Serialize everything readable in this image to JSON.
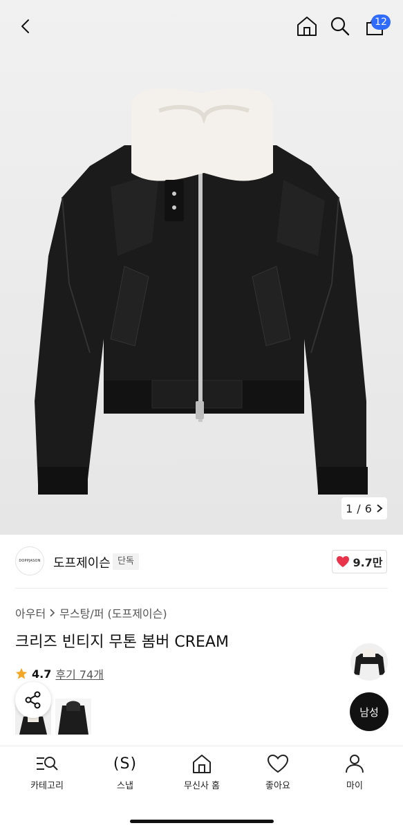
{
  "header": {
    "cart_count": "12",
    "back_icon": "chevron-left-icon",
    "home_icon": "home-icon",
    "search_icon": "search-icon",
    "bag_icon": "shopping-bag-icon"
  },
  "gallery": {
    "current": "1",
    "separator": "/",
    "total": "6",
    "next_icon": "chevron-right-icon"
  },
  "brand": {
    "logo_text": "DOPPJASON",
    "name": "도프제이슨",
    "tag": "단독",
    "likes": "9.7만"
  },
  "product": {
    "breadcrumb": [
      "아우터",
      "무스탕/퍼 (도프제이슨)"
    ],
    "title": "크리즈 빈티지 무톤 봄버 CREAM",
    "rating": "4.7",
    "reviews": "후기 74개"
  },
  "floating": {
    "gender": "남성"
  },
  "nav": {
    "items": [
      {
        "label": "카테고리",
        "icon": "category-icon"
      },
      {
        "label": "스냅",
        "icon": "snap-icon",
        "glyph": "(S)"
      },
      {
        "label": "무신사 홈",
        "icon": "home-icon"
      },
      {
        "label": "좋아요",
        "icon": "heart-icon"
      },
      {
        "label": "마이",
        "icon": "user-icon"
      }
    ]
  },
  "colors": {
    "accent_blue": "#2f6bff",
    "heart_red": "#e8334a",
    "star": "#f5a623"
  }
}
